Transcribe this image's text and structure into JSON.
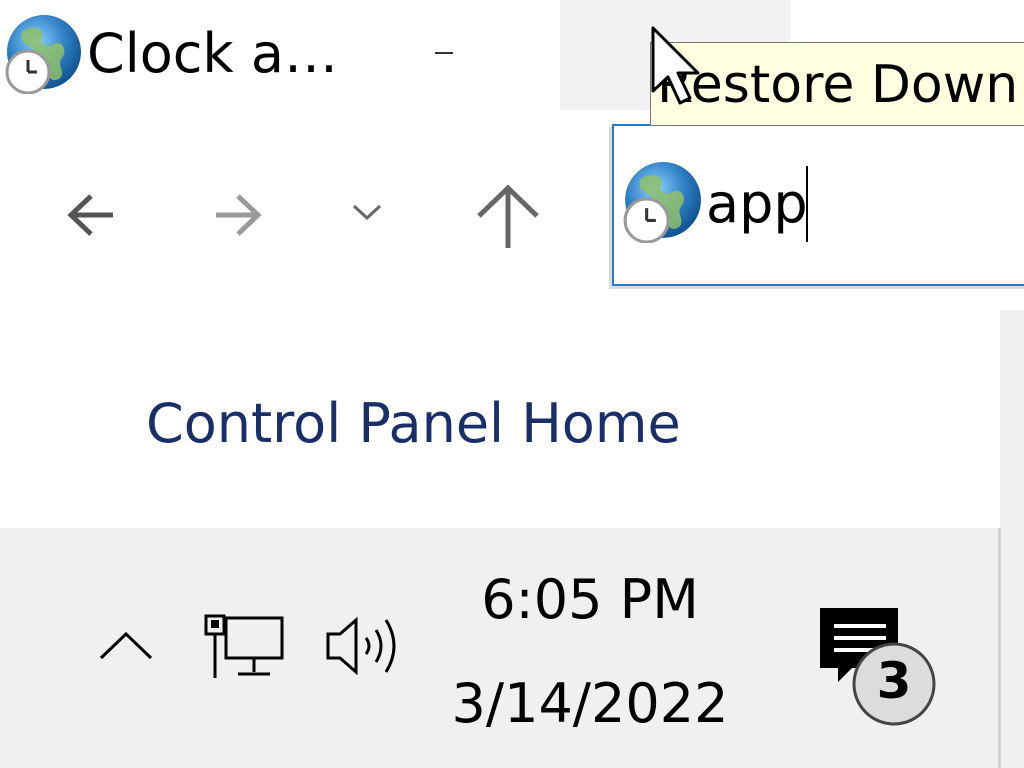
{
  "window": {
    "title": "Clock a…",
    "app_icon": "clock-globe-icon",
    "controls": {
      "minimize_icon": "minimize-icon",
      "restore_icon": "restore-icon"
    }
  },
  "tooltip": {
    "text": "Restore Down"
  },
  "navigation": {
    "back_icon": "arrow-left-icon",
    "forward_icon": "arrow-right-icon",
    "recent_icon": "chevron-down-icon",
    "up_icon": "arrow-up-icon"
  },
  "address_bar": {
    "value": "app",
    "icon": "clock-globe-icon"
  },
  "left_pane": {
    "home_link": "Control Panel Home"
  },
  "taskbar": {
    "hidden_icons": "chevron-up-icon",
    "network_icon": "network-icon",
    "volume_icon": "volume-icon",
    "time": "6:05 PM",
    "date": "3/14/2022",
    "notifications": {
      "icon": "action-center-icon",
      "count": "3"
    }
  },
  "colors": {
    "link": "#1a2f6a",
    "address_border": "#2b7ac8",
    "taskbar_bg": "#f0f0f0",
    "tooltip_bg": "#ffffe1"
  }
}
